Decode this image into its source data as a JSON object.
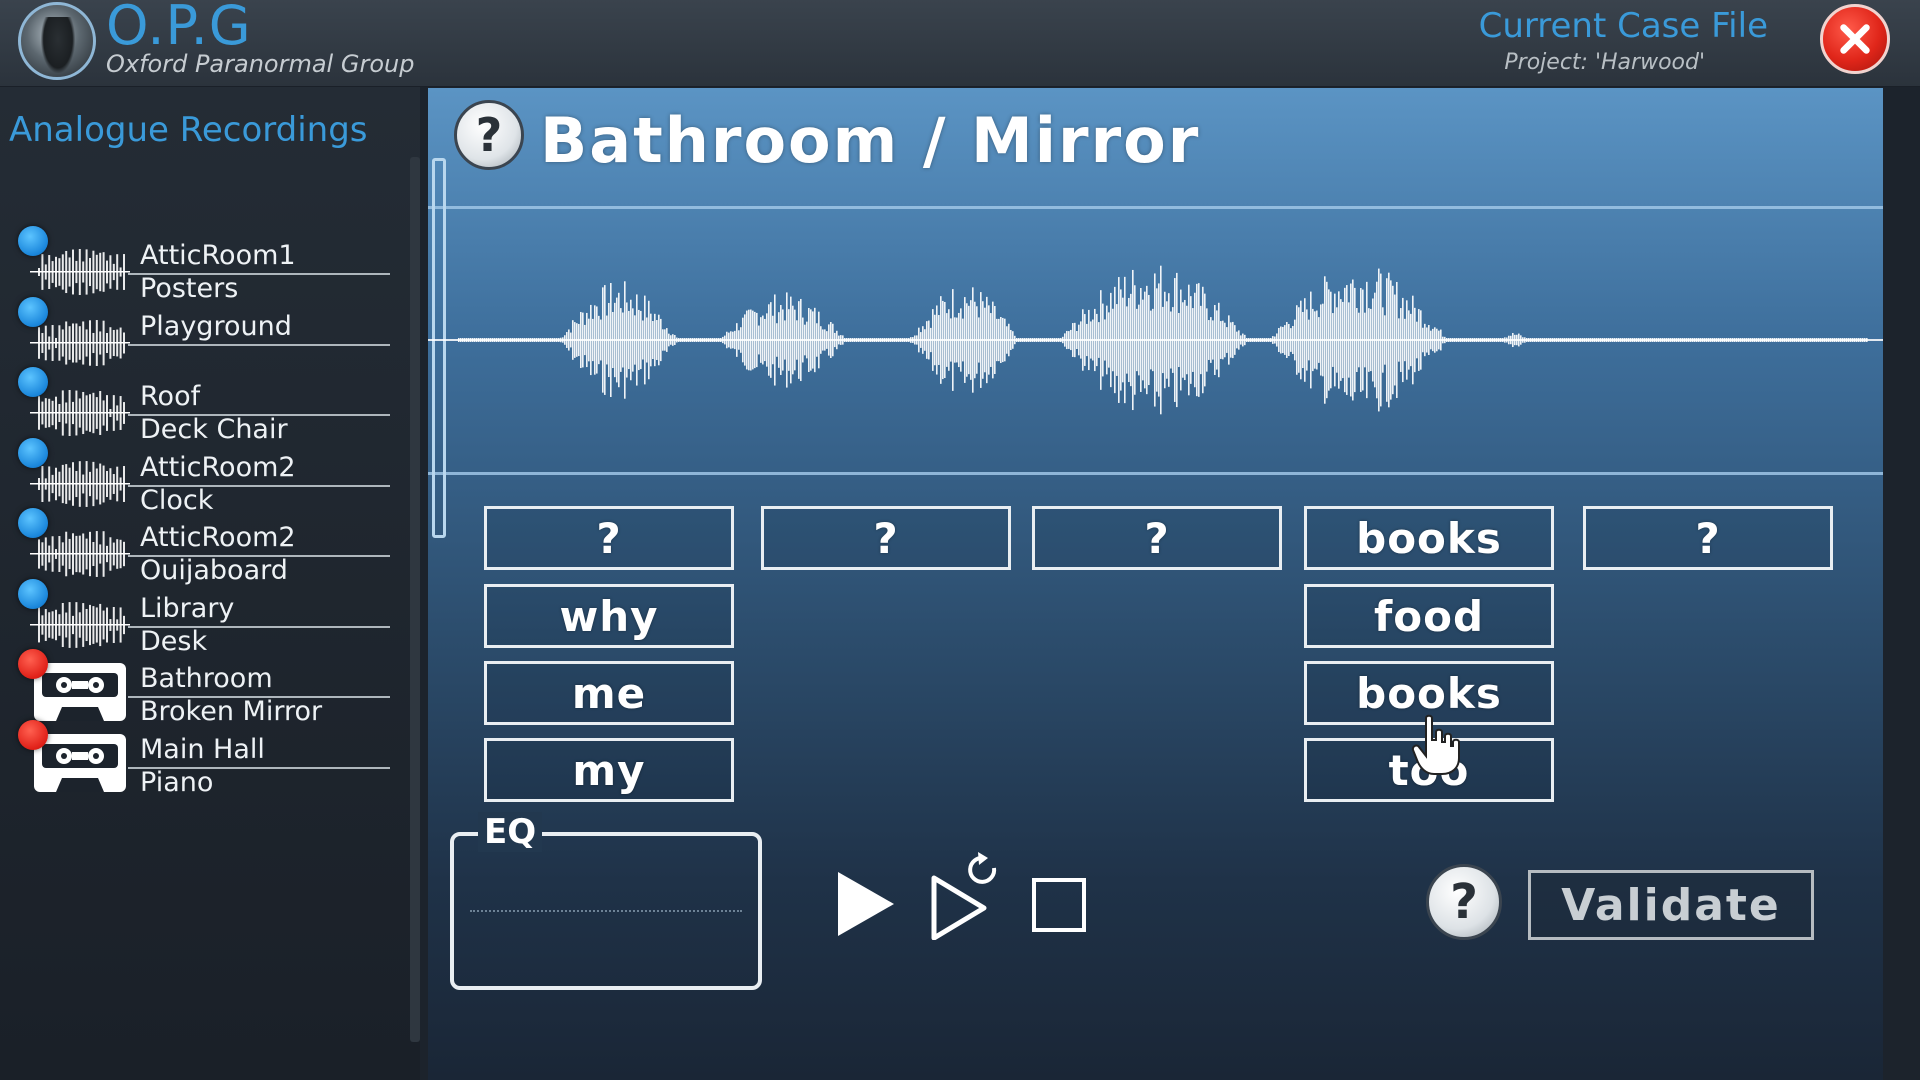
{
  "header": {
    "logo_title": "O.P.G",
    "logo_subtitle": "Oxford Paranormal Group",
    "case_title": "Current Case File",
    "case_project": "Project: 'Harwood'"
  },
  "sidebar": {
    "title": "Analogue Recordings",
    "items": [
      {
        "line1": "AtticRoom1",
        "line2": "Posters",
        "status": "blue",
        "type": "waveform"
      },
      {
        "line1": "Playground",
        "line2": "",
        "status": "blue",
        "type": "waveform"
      },
      {
        "line1": "Roof",
        "line2": "Deck Chair",
        "status": "blue",
        "type": "waveform"
      },
      {
        "line1": "AtticRoom2",
        "line2": "Clock",
        "status": "blue",
        "type": "waveform"
      },
      {
        "line1": "AtticRoom2",
        "line2": "Ouijaboard",
        "status": "blue",
        "type": "waveform"
      },
      {
        "line1": "Library",
        "line2": "Desk",
        "status": "blue",
        "type": "waveform"
      },
      {
        "line1": "Bathroom",
        "line2": "Broken Mirror",
        "status": "red",
        "type": "cassette"
      },
      {
        "line1": "Main Hall",
        "line2": "Piano",
        "status": "red",
        "type": "cassette"
      }
    ]
  },
  "main": {
    "title": "Bathroom / Mirror",
    "help_glyph": "?",
    "word_grid": {
      "col1": [
        "?",
        "why",
        "me",
        "my"
      ],
      "col2": [
        "?"
      ],
      "col3": [
        "?"
      ],
      "col4": [
        "books",
        "food",
        "books",
        "too"
      ],
      "col5": [
        "?"
      ]
    },
    "eq_label": "EQ",
    "validate_label": "Validate"
  },
  "colors": {
    "accent": "#3a9ad9",
    "panel_top": "#5b94c4",
    "status_unsolved": "#e02018",
    "status_solved": "#1a86db"
  },
  "icons": {
    "close": "close-x-icon",
    "play": "play-icon",
    "replay": "replay-icon",
    "stop": "stop-icon",
    "help": "help-question-icon"
  }
}
